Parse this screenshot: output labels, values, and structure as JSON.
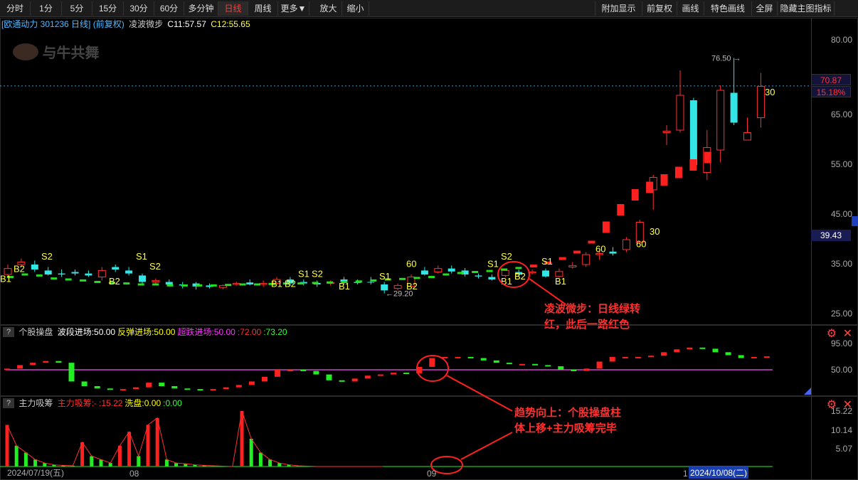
{
  "toolbar": {
    "periods": [
      "分时",
      "1分",
      "5分",
      "15分",
      "30分",
      "60分",
      "多分钟",
      "日线",
      "周线",
      "更多▼",
      "放大",
      "缩小"
    ],
    "active_period": "日线",
    "right_buttons": [
      "附加显示",
      "前复权",
      "画线",
      "特色画线",
      "全屏",
      "隐藏主图指标"
    ]
  },
  "main_panel": {
    "stock_title": "[欧通动力 301236 日线] (前复权)",
    "indicator_name": "凌波微步",
    "c1": "C11:57.57",
    "c2": "C12:55.65",
    "watermark": "与牛共舞",
    "y_ticks": [
      "80.00",
      "65.00",
      "55.00",
      "45.00",
      "35.00",
      "25.00"
    ],
    "high_label": "76.50",
    "low_label": "29.20",
    "current_price": "70.87",
    "current_pct": "15.18%",
    "cursor_price": "39.43",
    "annotation_1": "凌波微步：日线绿转红，此后一路红色",
    "annotation_1_line1": "凌波微步：日线绿转",
    "annotation_1_line2": "红，此后一路红色"
  },
  "panel2": {
    "name": "个股操盘",
    "items": [
      {
        "text": "波段进场:50.00",
        "color": "#ffffff"
      },
      {
        "text": "反弹进场:50.00",
        "color": "#ffff00"
      },
      {
        "text": "超跌进场:50.00",
        "color": "#ff33ff"
      },
      {
        "text": ":72.00",
        "color": "#ff3030"
      },
      {
        "text": ":73.20",
        "color": "#33ff33"
      }
    ],
    "y_ticks": [
      "95.00",
      "50.00"
    ],
    "annotation_2_line1": "趋势向上：个股操盘柱",
    "annotation_2_line2": "体上移+主力吸筹完毕"
  },
  "panel3": {
    "name": "主力吸筹",
    "items": [
      {
        "text": "主力吸筹:-",
        "color": "#ff3030"
      },
      {
        "text": ":15.22",
        "color": "#ff3030"
      },
      {
        "text": "洗盘:0.00",
        "color": "#ffff00"
      },
      {
        "text": ":0.00",
        "color": "#33ff33"
      }
    ],
    "y_ticks": [
      "15.22",
      "10.14",
      "5.07"
    ]
  },
  "dates": {
    "d1": "2024/07/19(五)",
    "d2": "08",
    "d3": "09",
    "d4": "1",
    "d5": "2024/10/08(二)"
  },
  "signals": {
    "labels": [
      "B1",
      "B2",
      "S2",
      "B2",
      "S1",
      "S2",
      "B1",
      "B2",
      "S1",
      "S2",
      "B1",
      "S1",
      "B2",
      "60",
      "S1",
      "S2",
      "B1",
      "B2",
      "S1",
      "B1",
      "60",
      "60",
      "30",
      "30"
    ]
  },
  "colors": {
    "up": "#ff3030",
    "down": "#33e6e6",
    "signal_text": "#ffff40",
    "bar_green": "#22ee22"
  },
  "chart_data": {
    "type": "candlestick",
    "yscale": [
      25,
      80
    ],
    "candles": [
      {
        "o": 33.0,
        "c": 34.2,
        "h": 35.0,
        "l": 32.5
      },
      {
        "o": 35.0,
        "c": 35.5,
        "h": 36.2,
        "l": 34.5
      },
      {
        "o": 35.0,
        "c": 34.0,
        "h": 35.8,
        "l": 33.5
      },
      {
        "o": 33.8,
        "c": 33.0,
        "h": 34.5,
        "l": 32.8
      },
      {
        "o": 33.2,
        "c": 33.0,
        "h": 34.0,
        "l": 32.5
      },
      {
        "o": 33.5,
        "c": 33.2,
        "h": 34.0,
        "l": 32.8
      },
      {
        "o": 33.2,
        "c": 32.8,
        "h": 33.8,
        "l": 32.5
      },
      {
        "o": 32.5,
        "c": 33.8,
        "h": 34.5,
        "l": 31.8
      },
      {
        "o": 34.5,
        "c": 34.0,
        "h": 35.0,
        "l": 33.5
      },
      {
        "o": 33.8,
        "c": 33.2,
        "h": 34.5,
        "l": 32.8
      },
      {
        "o": 32.8,
        "c": 31.5,
        "h": 33.2,
        "l": 31.2
      },
      {
        "o": 31.5,
        "c": 31.8,
        "h": 32.2,
        "l": 31.0
      },
      {
        "o": 31.5,
        "c": 31.0,
        "h": 32.0,
        "l": 30.8
      },
      {
        "o": 31.0,
        "c": 30.8,
        "h": 31.5,
        "l": 30.2
      },
      {
        "o": 31.2,
        "c": 30.6,
        "h": 31.5,
        "l": 30.0
      },
      {
        "o": 30.8,
        "c": 30.5,
        "h": 31.2,
        "l": 30.2
      },
      {
        "o": 30.4,
        "c": 30.8,
        "h": 31.0,
        "l": 30.0
      },
      {
        "o": 31.0,
        "c": 31.2,
        "h": 31.5,
        "l": 30.8
      },
      {
        "o": 31.4,
        "c": 31.0,
        "h": 32.0,
        "l": 30.8
      },
      {
        "o": 31.0,
        "c": 31.2,
        "h": 31.8,
        "l": 30.5
      },
      {
        "o": 31.2,
        "c": 32.0,
        "h": 32.5,
        "l": 31.0
      },
      {
        "o": 32.0,
        "c": 31.2,
        "h": 32.5,
        "l": 30.8
      },
      {
        "o": 31.5,
        "c": 31.2,
        "h": 32.0,
        "l": 30.8
      },
      {
        "o": 31.3,
        "c": 31.0,
        "h": 31.8,
        "l": 30.5
      },
      {
        "o": 31.2,
        "c": 31.4,
        "h": 31.8,
        "l": 30.8
      },
      {
        "o": 32.0,
        "c": 31.5,
        "h": 32.5,
        "l": 31.0
      },
      {
        "o": 31.5,
        "c": 31.3,
        "h": 32.0,
        "l": 31.0
      },
      {
        "o": 31.5,
        "c": 31.4,
        "h": 32.5,
        "l": 31.0
      },
      {
        "o": 31.0,
        "c": 29.8,
        "h": 31.5,
        "l": 29.2
      },
      {
        "o": 30.2,
        "c": 30.8,
        "h": 31.2,
        "l": 29.8
      },
      {
        "o": 30.6,
        "c": 32.5,
        "h": 33.0,
        "l": 30.4
      },
      {
        "o": 33.8,
        "c": 33.0,
        "h": 34.5,
        "l": 32.8
      },
      {
        "o": 33.5,
        "c": 34.2,
        "h": 34.8,
        "l": 33.2
      },
      {
        "o": 34.2,
        "c": 33.6,
        "h": 34.8,
        "l": 33.2
      },
      {
        "o": 33.8,
        "c": 33.0,
        "h": 34.3,
        "l": 32.6
      },
      {
        "o": 32.8,
        "c": 32.6,
        "h": 33.2,
        "l": 32.2
      },
      {
        "o": 32.5,
        "c": 32.0,
        "h": 33.0,
        "l": 31.8
      },
      {
        "o": 32.8,
        "c": 33.8,
        "h": 34.2,
        "l": 32.5
      },
      {
        "o": 33.5,
        "c": 33.0,
        "h": 34.0,
        "l": 32.6
      },
      {
        "o": 33.3,
        "c": 33.5,
        "h": 34.0,
        "l": 33.0
      },
      {
        "o": 33.8,
        "c": 32.6,
        "h": 34.2,
        "l": 32.4
      },
      {
        "o": 32.6,
        "c": 33.6,
        "h": 34.2,
        "l": 32.4
      },
      {
        "o": 34.5,
        "c": 34.8,
        "h": 35.5,
        "l": 34.2
      },
      {
        "o": 35.0,
        "c": 37.0,
        "h": 37.5,
        "l": 34.5
      },
      {
        "o": 37.0,
        "c": 37.2,
        "h": 37.6,
        "l": 36.0
      },
      {
        "o": 37.6,
        "c": 37.2,
        "h": 38.5,
        "l": 36.8
      },
      {
        "o": 38.0,
        "c": 40.0,
        "h": 40.5,
        "l": 37.5
      },
      {
        "o": 39.5,
        "c": 43.5,
        "h": 44.0,
        "l": 39.0
      },
      {
        "o": 50.0,
        "c": 52.5,
        "h": 53.0,
        "l": 46.0
      },
      {
        "o": 61.5,
        "c": 61.8,
        "h": 63.0,
        "l": 59.0
      },
      {
        "o": 62.0,
        "c": 69.0,
        "h": 74.0,
        "l": 61.5
      },
      {
        "o": 68.0,
        "c": 55.0,
        "h": 68.5,
        "l": 55.0
      },
      {
        "o": 53.5,
        "c": 58.5,
        "h": 62.0,
        "l": 52.0
      },
      {
        "o": 58.0,
        "c": 70.0,
        "h": 71.0,
        "l": 55.5
      },
      {
        "o": 69.5,
        "c": 63.5,
        "h": 76.5,
        "l": 63.0
      },
      {
        "o": 60.0,
        "c": 61.5,
        "h": 64.5,
        "l": 60.0
      },
      {
        "o": 64.5,
        "c": 70.8,
        "h": 73.5,
        "l": 62.5
      }
    ],
    "series_red_dashes": [
      32.5,
      33.0,
      32.8,
      32.2,
      32.0,
      31.8,
      31.5,
      31.3,
      31.2,
      31.0,
      31.0,
      30.8,
      30.8,
      30.8,
      30.8,
      30.9,
      31.0,
      31.0,
      31.1,
      31.2,
      31.2,
      31.3,
      31.4,
      31.5,
      31.6,
      31.8,
      32.0,
      32.1,
      32.3,
      32.5,
      33.0,
      33.3,
      33.5,
      33.7,
      34.0,
      34.3,
      34.7,
      35.3,
      36.2,
      37.5,
      39.5,
      42.5,
      46.0,
      49.0,
      50.5,
      52.0,
      53.5,
      55.0,
      56.5
    ],
    "panel2_bars": [
      52,
      58,
      62,
      65,
      62,
      30,
      22,
      18,
      16,
      17,
      20,
      28,
      22,
      18,
      17,
      16,
      17,
      20,
      24,
      30,
      38,
      50,
      50,
      48,
      42,
      32,
      30,
      35,
      40,
      42,
      45,
      44,
      55,
      70,
      72,
      72,
      70,
      66,
      62,
      60,
      60,
      58,
      56,
      50,
      48,
      52,
      64,
      72,
      72,
      72,
      74,
      80,
      85,
      88,
      86,
      80,
      75,
      70,
      72,
      73,
      73
    ],
    "panel3_bars": [
      12,
      6,
      4,
      2,
      1,
      0.5,
      0.3,
      0.2,
      7,
      3,
      2,
      1,
      6,
      10,
      3,
      12,
      14,
      2,
      1,
      0.8,
      0.5,
      0.3,
      0.2,
      0.1,
      0,
      16,
      8,
      4,
      2,
      1,
      0.5,
      0.2,
      0.1,
      0,
      0,
      0,
      0,
      0,
      0,
      0,
      0
    ]
  }
}
